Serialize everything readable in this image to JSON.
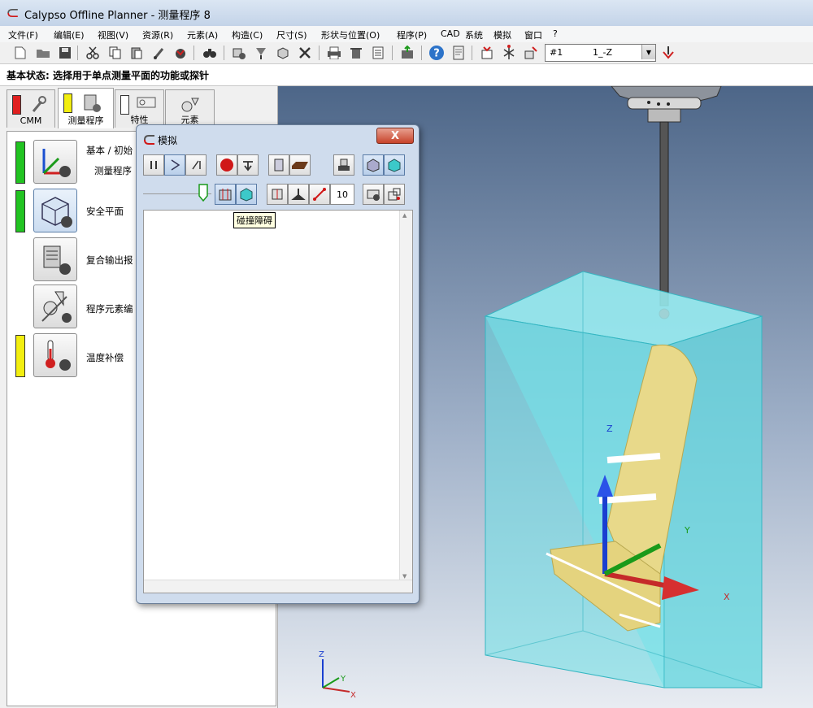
{
  "window": {
    "title": "Calypso Offline Planner - 测量程序 8"
  },
  "menu": [
    "文件(F)",
    "编辑(E)",
    "视图(V)",
    "资源(R)",
    "元素(A)",
    "构造(C)",
    "尺寸(S)",
    "形状与位置(O)",
    "程序(P)",
    "CAD",
    "系统",
    "模拟",
    "窗口",
    "?"
  ],
  "toolbar": {
    "combo_left": "#1",
    "combo_right": "1_-Z"
  },
  "status": {
    "text": "基本状态: 选择用于单点测量平面的功能或探针"
  },
  "left_tabs": [
    {
      "label": "CMM",
      "swatch": "#e02020"
    },
    {
      "label": "测量程序",
      "swatch": "#f2ee10"
    },
    {
      "label": "特性",
      "swatch": "#ffffff"
    },
    {
      "label": "元素",
      "swatch": ""
    }
  ],
  "program_items": [
    {
      "label": "基本 / 初始",
      "sublabel": "测量程序",
      "status_color": "#22c322"
    },
    {
      "label": "安全平面",
      "sublabel": "",
      "status_color": "#22c322"
    },
    {
      "label": "复合输出报",
      "sublabel": "",
      "status_color": ""
    },
    {
      "label": "程序元素编",
      "sublabel": "",
      "status_color": ""
    },
    {
      "label": "温度补偿",
      "sublabel": "",
      "status_color": "#f2ee10"
    }
  ],
  "dialog": {
    "title": "模拟",
    "close_label": "X",
    "step_value": "10",
    "tooltip": "碰撞障碍"
  },
  "viewport": {
    "axis_labels": {
      "x": "X",
      "y": "Y",
      "z": "Z"
    },
    "mini_axes": {
      "x": "X",
      "y": "Y",
      "z": "Z"
    }
  },
  "colors": {
    "accent_red": "#e02020",
    "accent_green": "#22c322",
    "accent_yellow": "#f2ee10",
    "box_fill": "#7ee8ee",
    "part_fill": "#e8d98a"
  }
}
